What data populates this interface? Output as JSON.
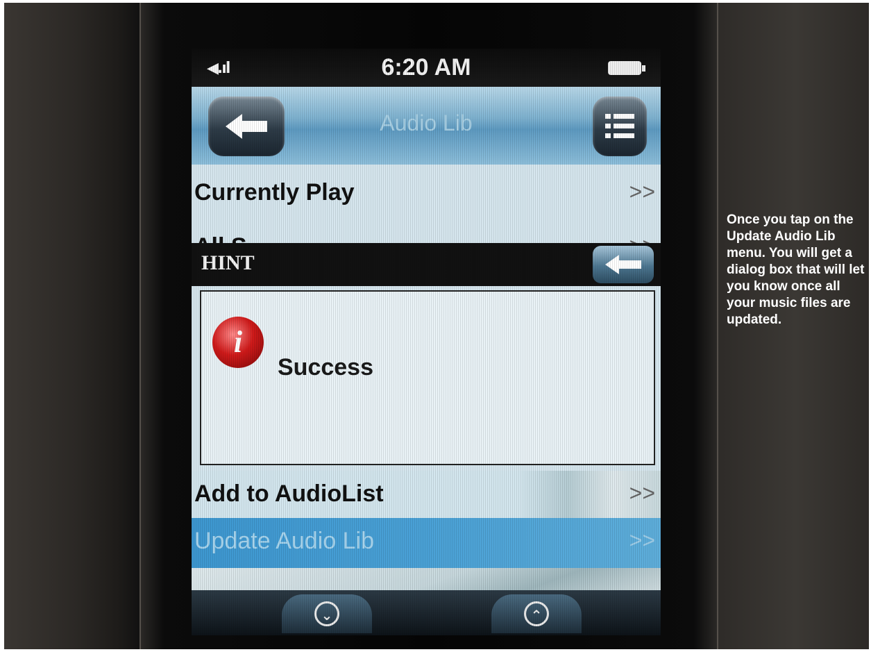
{
  "status_bar": {
    "signal": "◀.ıl",
    "time": "6:20 AM",
    "battery_icon": "battery-icon"
  },
  "title_bar": {
    "title": "Audio Lib",
    "back_icon": "back-arrow-icon",
    "menu_icon": "list-menu-icon"
  },
  "menu_items_top": [
    {
      "label": "Currently Play",
      "arrow": ">>"
    },
    {
      "label": "All S",
      "arrow": ">>"
    }
  ],
  "hint_dialog": {
    "title": "HINT",
    "message": "Success",
    "icon": "info-icon",
    "icon_glyph": "i"
  },
  "menu_items_bottom": [
    {
      "label": "Add to AudioList",
      "arrow": ">>",
      "selected": false
    },
    {
      "label": "Update Audio Lib",
      "arrow": ">>",
      "selected": true
    }
  ],
  "nav_bar": {
    "down_icon": "scroll-down-icon",
    "up_icon": "scroll-up-icon",
    "down_glyph": "⌄",
    "up_glyph": "⌃"
  },
  "caption": {
    "text": "Once you tap on the Update Audio Lib menu. You will get a dialog box that will let you know once all your music files are updated."
  },
  "colors": {
    "title_bar": "#7fb3d1",
    "selected_row": "#4aa1d6",
    "hint_icon": "#d01a1a"
  }
}
